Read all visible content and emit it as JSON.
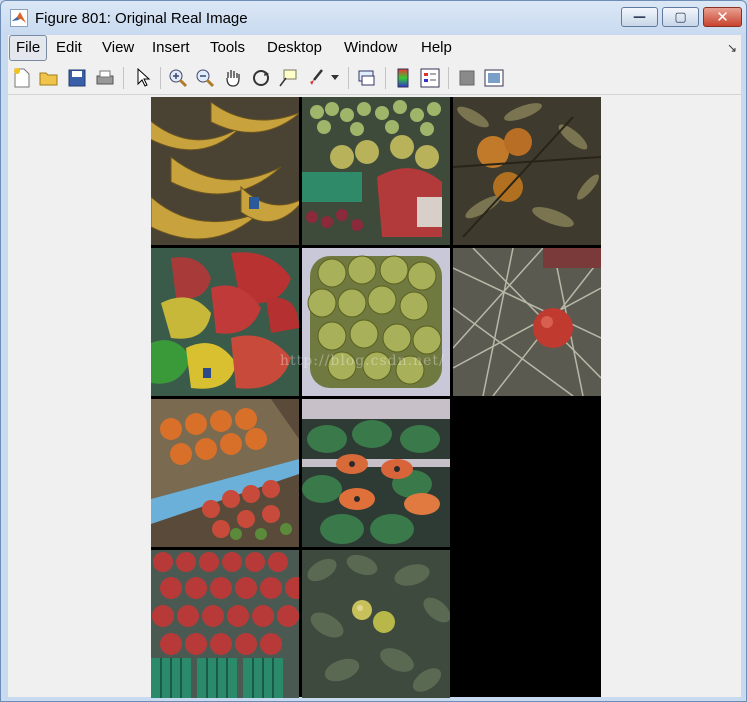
{
  "window": {
    "title": "Figure 801: Original Real Image",
    "controls": {
      "minimize": "—",
      "maximize": "▢",
      "close": "✕"
    }
  },
  "menubar": {
    "items": [
      {
        "label": "File"
      },
      {
        "label": "Edit"
      },
      {
        "label": "View"
      },
      {
        "label": "Insert"
      },
      {
        "label": "Tools"
      },
      {
        "label": "Desktop"
      },
      {
        "label": "Window"
      },
      {
        "label": "Help"
      }
    ],
    "dock_glyph": "↘"
  },
  "toolbar": {
    "tools": [
      "new-figure-icon",
      "open-file-icon",
      "save-icon",
      "print-icon",
      "pointer-icon",
      "zoom-in-icon",
      "zoom-out-icon",
      "pan-hand-icon",
      "rotate-3d-icon",
      "data-cursor-icon",
      "brush-icon",
      "link-plot-icon",
      "colorbar-icon",
      "legend-icon",
      "hide-plot-tools-icon",
      "show-plot-tools-icon"
    ]
  },
  "figure": {
    "tiles": [
      {
        "name": "bananas",
        "base": "#7a6a3a"
      },
      {
        "name": "grapes-berries",
        "base": "#5a6a4a"
      },
      {
        "name": "oranges-branch",
        "base": "#6b5a3a"
      },
      {
        "name": "peppers",
        "base": "#7a4a3a"
      },
      {
        "name": "green-apples",
        "base": "#6a7040"
      },
      {
        "name": "pomegranate",
        "base": "#6a6a5a"
      },
      {
        "name": "oranges-crates",
        "base": "#6a5a4a"
      },
      {
        "name": "papayas",
        "base": "#4a5a4a"
      },
      {
        "name": "tomatoes",
        "base": "#6a4a48"
      },
      {
        "name": "citrus-tree",
        "base": "#4e5a48"
      }
    ],
    "watermark": "http://blog.csdn.net/"
  }
}
